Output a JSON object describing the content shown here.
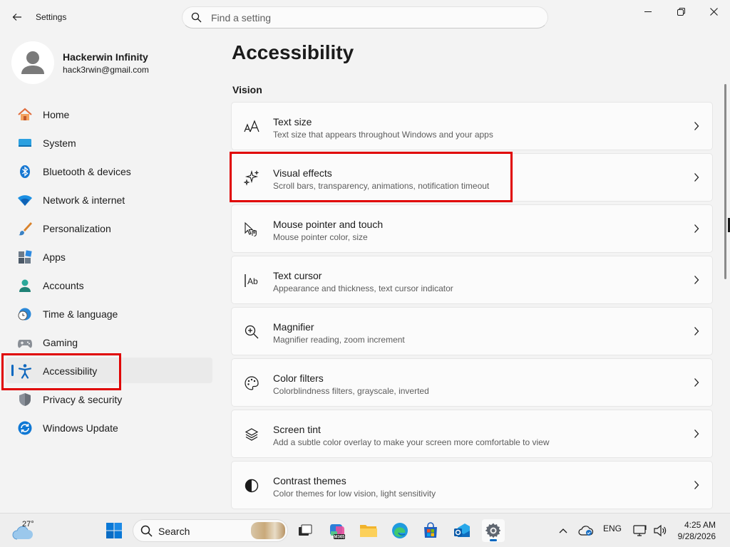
{
  "window": {
    "title": "Settings",
    "search_placeholder": "Find a setting"
  },
  "profile": {
    "name": "Hackerwin Infinity",
    "email": "hack3rwin@gmail.com"
  },
  "nav": [
    {
      "label": "Home",
      "icon": "home-icon"
    },
    {
      "label": "System",
      "icon": "system-icon"
    },
    {
      "label": "Bluetooth & devices",
      "icon": "bluetooth-icon"
    },
    {
      "label": "Network & internet",
      "icon": "wifi-icon"
    },
    {
      "label": "Personalization",
      "icon": "brush-icon"
    },
    {
      "label": "Apps",
      "icon": "apps-icon"
    },
    {
      "label": "Accounts",
      "icon": "accounts-icon"
    },
    {
      "label": "Time & language",
      "icon": "globe-clock-icon"
    },
    {
      "label": "Gaming",
      "icon": "gamepad-icon"
    },
    {
      "label": "Accessibility",
      "icon": "accessibility-icon",
      "selected": true
    },
    {
      "label": "Privacy & security",
      "icon": "shield-icon"
    },
    {
      "label": "Windows Update",
      "icon": "update-icon"
    }
  ],
  "main": {
    "page_title": "Accessibility",
    "section": "Vision",
    "cards": [
      {
        "title": "Text size",
        "subtitle": "Text size that appears throughout Windows and your apps",
        "icon": "text-size-icon"
      },
      {
        "title": "Visual effects",
        "subtitle": "Scroll bars, transparency, animations, notification timeout",
        "icon": "sparkle-icon"
      },
      {
        "title": "Mouse pointer and touch",
        "subtitle": "Mouse pointer color, size",
        "icon": "pointer-icon"
      },
      {
        "title": "Text cursor",
        "subtitle": "Appearance and thickness, text cursor indicator",
        "icon": "text-cursor-icon"
      },
      {
        "title": "Magnifier",
        "subtitle": "Magnifier reading, zoom increment",
        "icon": "magnifier-icon"
      },
      {
        "title": "Color filters",
        "subtitle": "Colorblindness filters, grayscale, inverted",
        "icon": "palette-icon"
      },
      {
        "title": "Screen tint",
        "subtitle": "Add a subtle color overlay to make your screen more comfortable to view",
        "icon": "layers-icon"
      },
      {
        "title": "Contrast themes",
        "subtitle": "Color themes for low vision, light sensitivity",
        "icon": "contrast-icon"
      }
    ]
  },
  "taskbar": {
    "weather_temp": "27°",
    "search_label": "Search",
    "language": "ENG",
    "m365_label": "M365",
    "time": "4:25 AM",
    "date": "9/28/2026"
  },
  "colors": {
    "accent": "#0067c0",
    "highlight": "#e00000"
  }
}
